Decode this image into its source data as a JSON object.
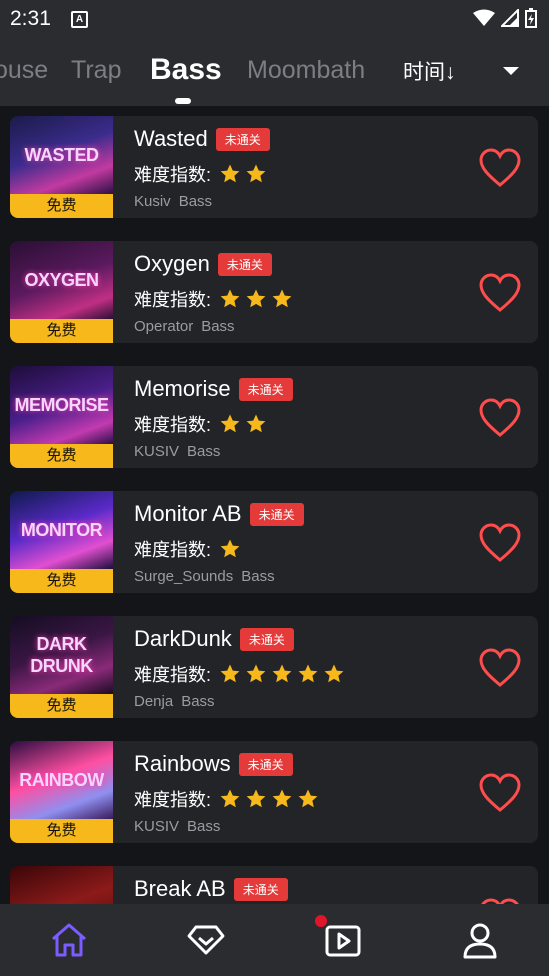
{
  "status_bar": {
    "time": "2:31",
    "app_icon_letter": "A"
  },
  "tabs": [
    {
      "label": "ouse"
    },
    {
      "label": "Trap"
    },
    {
      "label": "Bass",
      "active": true
    },
    {
      "label": "Moombath"
    }
  ],
  "sort": {
    "label": "时间↓"
  },
  "free_label": "免费",
  "difficulty_label": "难度指数:",
  "songs": [
    {
      "title": "Wasted",
      "status": "未通关",
      "stars": 2,
      "artist": "Kusiv",
      "genre": "Bass",
      "cover_text": "WASTED"
    },
    {
      "title": "Oxygen",
      "status": "未通关",
      "stars": 3,
      "artist": "Operator",
      "genre": "Bass",
      "cover_text": "OXYGEN"
    },
    {
      "title": "Memorise",
      "status": "未通关",
      "stars": 2,
      "artist": "KUSIV",
      "genre": "Bass",
      "cover_text": "MEMORISE"
    },
    {
      "title": "Monitor AB",
      "status": "未通关",
      "stars": 1,
      "artist": "Surge_Sounds",
      "genre": "Bass",
      "cover_text": "MONITOR"
    },
    {
      "title": "DarkDunk",
      "status": "未通关",
      "stars": 5,
      "artist": "Denja",
      "genre": "Bass",
      "cover_text": "DARK DRUNK"
    },
    {
      "title": "Rainbows",
      "status": "未通关",
      "stars": 4,
      "artist": "KUSIV",
      "genre": "Bass",
      "cover_text": "RAINBOW"
    },
    {
      "title": "Break AB",
      "status": "未通关",
      "stars": 0,
      "artist": "",
      "genre": "",
      "cover_text": ""
    }
  ],
  "colors": {
    "accent": "#7b5cff",
    "heart": "#ff4c4c",
    "star": "#f6b81b",
    "tag": "#e43a3a",
    "badge": "#f6b81b"
  },
  "bottom_nav": [
    {
      "name": "home-icon",
      "active": true
    },
    {
      "name": "diamond-icon"
    },
    {
      "name": "video-icon",
      "notification": true
    },
    {
      "name": "profile-icon"
    }
  ]
}
